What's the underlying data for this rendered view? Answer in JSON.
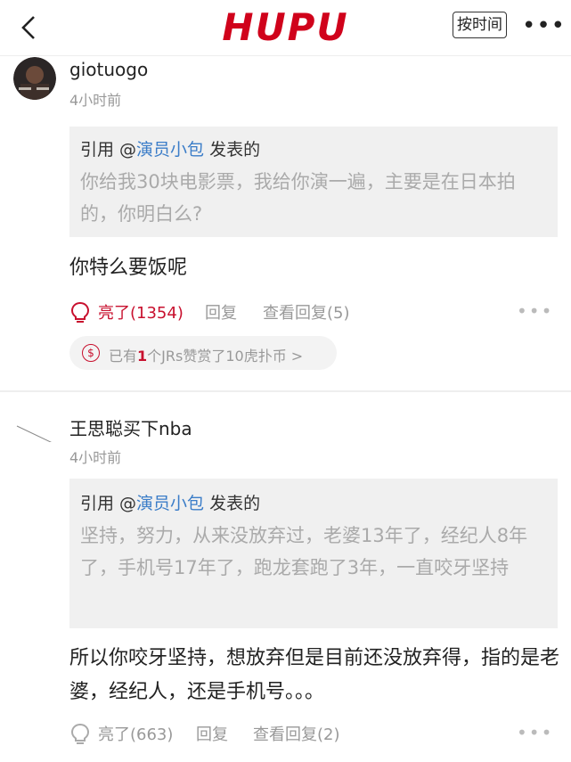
{
  "header": {
    "logo": "HUPU",
    "sort_label": "按时间",
    "more_label": "•••",
    "icons": [
      "back-chevron-icon",
      "more-icon"
    ]
  },
  "posts": [
    {
      "username": "giotuogo",
      "time": "4小时前",
      "quote": {
        "prefix": "引用 @",
        "author": "演员小包",
        "suffix": " 发表的",
        "text": "你给我30块电影票，我给你演一遍，主要是在日本拍的，你明白么?"
      },
      "body": "你特么要饭呢",
      "like_label": "亮了(1354)",
      "reply_label": "回复",
      "view_replies_label": "查看回复(5)",
      "more": "•••",
      "tip": {
        "coin": "$",
        "prefix": "已有",
        "count": "1",
        "suffix": "个JRs赞赏了10虎扑币 >"
      }
    },
    {
      "username": "王思聪买下nba",
      "time": "4小时前",
      "quote": {
        "prefix": "引用 @",
        "author": "演员小包",
        "suffix": " 发表的",
        "text": "坚持，努力，从来没放弃过，老婆13年了，经纪人8年了，手机号17年了，跑龙套跑了3年，一直咬牙坚持"
      },
      "body": "所以你咬牙坚持，想放弃但是目前还没放弃得，指的是老婆，经纪人，还是手机号。。。",
      "like_label": "亮了(663)",
      "reply_label": "回复",
      "view_replies_label": "查看回复(2)",
      "more": "•••"
    }
  ],
  "colors": {
    "brand": "#d0021b",
    "link": "#3b7dc8",
    "muted": "#999999",
    "quote_bg": "#f0f0f0"
  }
}
